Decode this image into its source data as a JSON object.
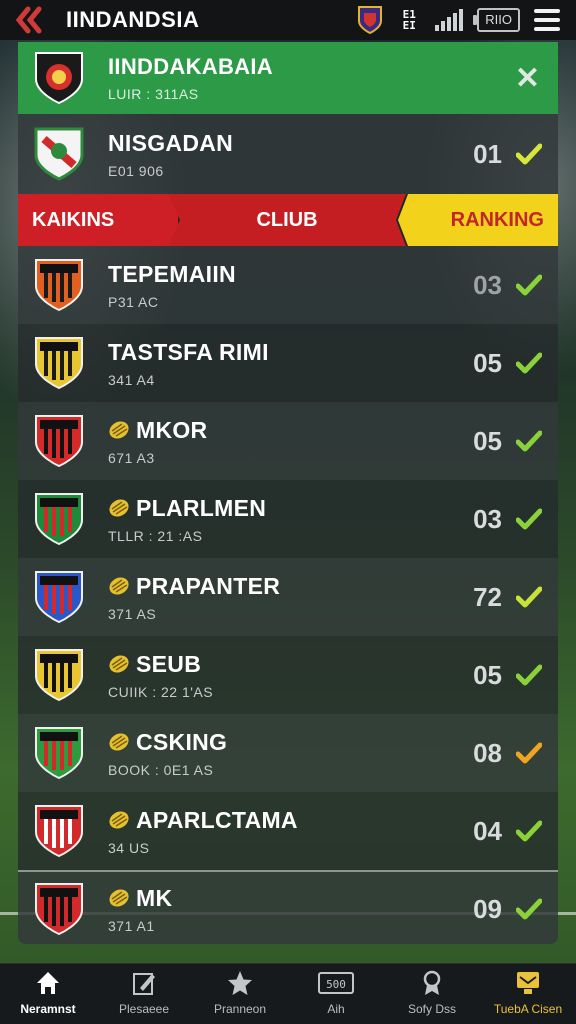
{
  "app": {
    "title": "IINDANDSIA"
  },
  "status": {
    "grid_text": [
      "E1",
      "EI"
    ],
    "battery_text": "RIIO"
  },
  "header_team": {
    "name": "IINDDAKABAIA",
    "sub": "LUIR : 311AS"
  },
  "top_team": {
    "name": "NISGADAN",
    "sub": "E01 906",
    "rank": "01",
    "check_color": "#d7e63b"
  },
  "ranking_bar": {
    "left": "KAIKINS",
    "middle": "CLIUB",
    "right": "RANKING"
  },
  "teams": [
    {
      "name": "TEPEMAIIN",
      "sub": "P31 AC",
      "rank": "03",
      "has_ball": false,
      "check_color": "#8bd13a",
      "dim": true
    },
    {
      "name": "TASTSFA RIMI",
      "sub": "341 A4",
      "rank": "05",
      "has_ball": false,
      "check_color": "#8bd13a",
      "dim": false
    },
    {
      "name": "MKOR",
      "sub": "671 A3",
      "rank": "05",
      "has_ball": true,
      "check_color": "#8bd13a",
      "dim": false
    },
    {
      "name": "PLARLMEN",
      "sub": "TLLR : 21 :AS",
      "rank": "03",
      "has_ball": true,
      "check_color": "#8bd13a",
      "dim": false
    },
    {
      "name": "PRAPANTER",
      "sub": "371 AS",
      "rank": "72",
      "has_ball": true,
      "check_color": "#c8e23a",
      "dim": false
    },
    {
      "name": "SEUB",
      "sub": "CUIIK : 22 1'AS",
      "rank": "05",
      "has_ball": true,
      "check_color": "#8bd13a",
      "dim": false
    },
    {
      "name": "CSKING",
      "sub": "BOOK : 0E1 AS",
      "rank": "08",
      "has_ball": true,
      "check_color": "#f0a521",
      "dim": false
    },
    {
      "name": "APARLCTAMA",
      "sub": "34 US",
      "rank": "04",
      "has_ball": true,
      "check_color": "#8bd13a",
      "dim": false
    },
    {
      "name": "MK",
      "sub": "371 A1",
      "rank": "09",
      "has_ball": true,
      "check_color": "#8bd13a",
      "dim": false
    }
  ],
  "nav": [
    {
      "label": "Neramnst",
      "icon": "home-icon"
    },
    {
      "label": "Plesaeee",
      "icon": "edit-icon"
    },
    {
      "label": "Pranneon",
      "icon": "star-icon"
    },
    {
      "label": "Aih",
      "icon": "scoreboard-icon"
    },
    {
      "label": "Sofy Dss",
      "icon": "badge-icon"
    },
    {
      "label": "TuebA Cisen",
      "icon": "trophy-icon"
    }
  ],
  "colors": {
    "accent_green": "#2d9a48",
    "accent_red": "#cf1f26",
    "accent_yellow": "#f3d21c"
  }
}
